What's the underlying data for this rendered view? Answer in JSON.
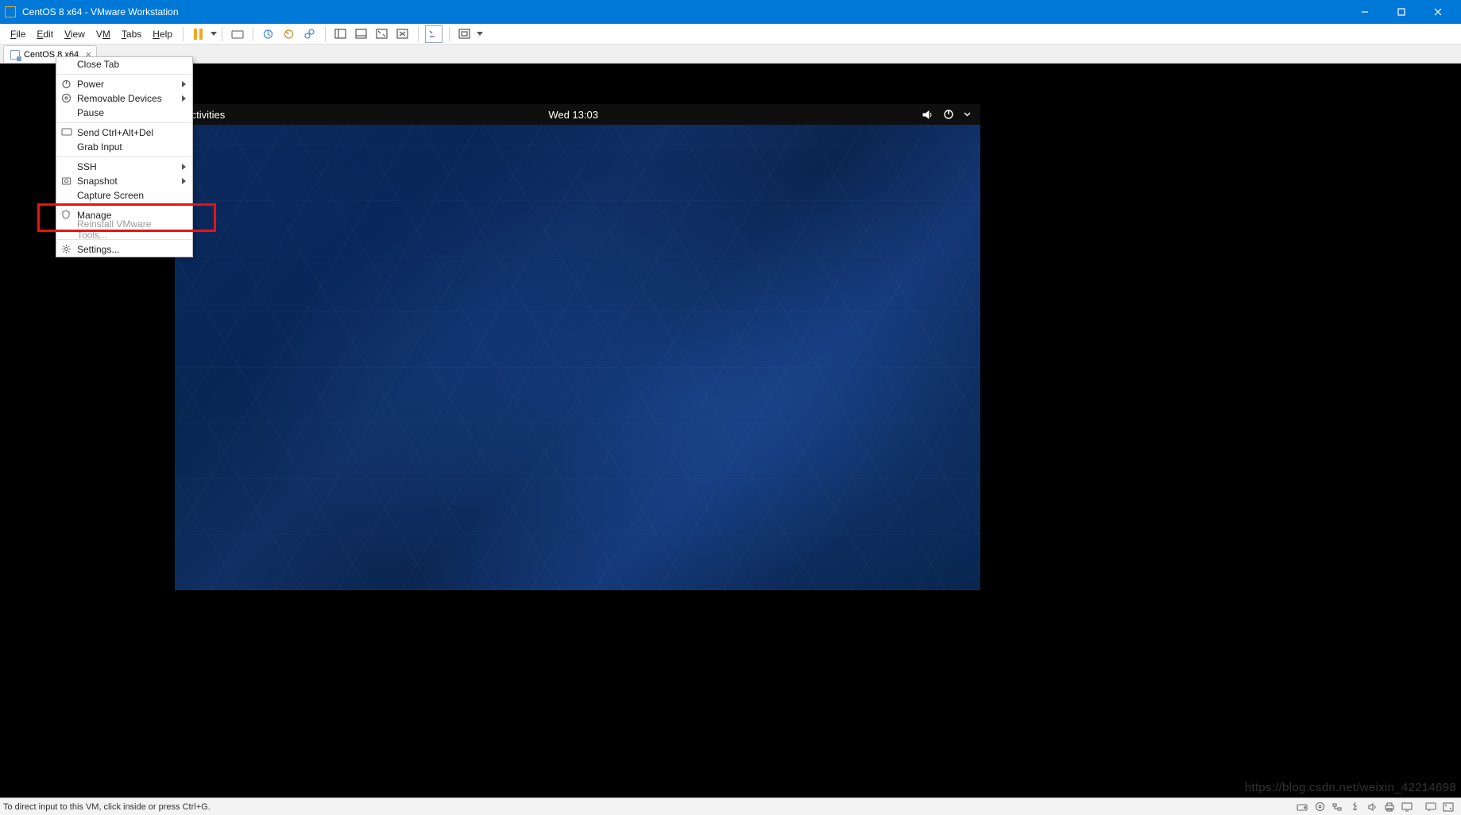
{
  "window": {
    "title": "CentOS 8 x64 - VMware Workstation"
  },
  "menubar": {
    "file": "File",
    "edit": "Edit",
    "view": "View",
    "vm": "VM",
    "tabs": "Tabs",
    "help": "Help"
  },
  "tab": {
    "label": "CentOS 8 x64"
  },
  "context_menu": {
    "close_tab": "Close Tab",
    "power": "Power",
    "removable_devices": "Removable Devices",
    "pause": "Pause",
    "send_cad": "Send Ctrl+Alt+Del",
    "grab_input": "Grab Input",
    "ssh": "SSH",
    "snapshot": "Snapshot",
    "capture_screen": "Capture Screen",
    "manage": "Manage",
    "reinstall_tools": "Reinstall VMware Tools...",
    "settings": "Settings..."
  },
  "guest": {
    "activities": "Activities",
    "clock": "Wed 13:03"
  },
  "statusbar": {
    "hint": "To direct input to this VM, click inside or press Ctrl+G."
  },
  "watermark": "https://blog.csdn.net/weixin_42214698"
}
